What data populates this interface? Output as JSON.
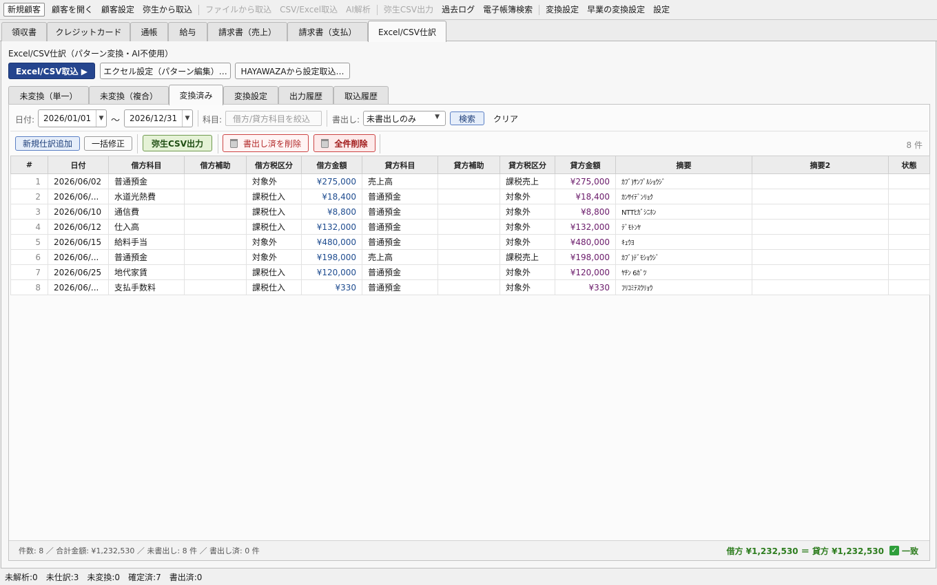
{
  "menu": {
    "new_customer": "新規顧客",
    "open_customer": "顧客を開く",
    "customer_settings": "顧客設定",
    "import_yayoi": "弥生から取込",
    "import_file": "ファイルから取込",
    "import_csv_excel": "CSV/Excel取込",
    "ai_analysis": "AI解析",
    "yayoi_csv_export": "弥生CSV出力",
    "past_log": "過去ログ",
    "e_ledger_search": "電子帳簿検索",
    "conversion_settings": "変換設定",
    "hayawaza_settings": "早業の変換設定",
    "settings": "設定"
  },
  "main_tabs": [
    "領収書",
    "クレジットカード",
    "通帳",
    "給与",
    "請求書（売上）",
    "請求書（支払）",
    "Excel/CSV仕訳"
  ],
  "panel": {
    "title": "Excel/CSV仕訳（パターン変換・AI不使用）",
    "import_button": "Excel/CSV取込 ▶",
    "excel_settings_button": "エクセル設定（パターン編集）…",
    "hayawaza_import_button": "HAYAWAZAから設定取込…"
  },
  "sub_tabs": [
    "未変換（単一）",
    "未変換（複合）",
    "変換済み",
    "変換設定",
    "出力履歴",
    "取込履歴"
  ],
  "filter": {
    "date_label": "日付:",
    "date_from": "2026/01/01",
    "tilde": "〜",
    "date_to": "2026/12/31",
    "account_label": "科目:",
    "account_placeholder": "借方/貸方科目を絞込",
    "export_label": "書出し:",
    "export_value": "未書出しのみ",
    "search_button": "検索",
    "clear_button": "クリア"
  },
  "actions": {
    "new_entry": "新規仕訳追加",
    "bulk_edit": "一括修正",
    "yayoi_csv": "弥生CSV出力",
    "delete_exported": "書出し済を削除",
    "delete_all": "全件削除",
    "count": "8 件"
  },
  "table": {
    "headers": [
      "#",
      "日付",
      "借方科目",
      "借方補助",
      "借方税区分",
      "借方金額",
      "貸方科目",
      "貸方補助",
      "貸方税区分",
      "貸方金額",
      "摘要",
      "摘要2",
      "状態"
    ],
    "rows": [
      {
        "num": "1",
        "date": "2026/06/02",
        "debit": "普通預金",
        "dsub": "",
        "dtax": "対象外",
        "damt": "¥275,000",
        "credit": "売上高",
        "csub": "",
        "ctax": "課税売上",
        "camt": "¥275,000",
        "memo": "ｶﾌﾞ)ｻﾝﾌﾟﾙｼｮｳｼﾞ",
        "memo2": "",
        "status": ""
      },
      {
        "num": "2",
        "date": "2026/06/...",
        "debit": "水道光熱費",
        "dsub": "",
        "dtax": "課税仕入",
        "damt": "¥18,400",
        "credit": "普通預金",
        "csub": "",
        "ctax": "対象外",
        "camt": "¥18,400",
        "memo": "ｶﾝｻｲﾃﾞﾝﾘｮｸ",
        "memo2": "",
        "status": ""
      },
      {
        "num": "3",
        "date": "2026/06/10",
        "debit": "通信費",
        "dsub": "",
        "dtax": "課税仕入",
        "damt": "¥8,800",
        "credit": "普通預金",
        "csub": "",
        "ctax": "対象外",
        "camt": "¥8,800",
        "memo": "NTTﾋｶﾞｼﾆﾎﾝ",
        "memo2": "",
        "status": ""
      },
      {
        "num": "4",
        "date": "2026/06/12",
        "debit": "仕入高",
        "dsub": "",
        "dtax": "課税仕入",
        "damt": "¥132,000",
        "credit": "普通預金",
        "csub": "",
        "ctax": "対象外",
        "camt": "¥132,000",
        "memo": "ﾃﾞﾓﾄﾝﾔ",
        "memo2": "",
        "status": ""
      },
      {
        "num": "5",
        "date": "2026/06/15",
        "debit": "給料手当",
        "dsub": "",
        "dtax": "対象外",
        "damt": "¥480,000",
        "credit": "普通預金",
        "csub": "",
        "ctax": "対象外",
        "camt": "¥480,000",
        "memo": "ｷｭｳﾖ",
        "memo2": "",
        "status": ""
      },
      {
        "num": "6",
        "date": "2026/06/...",
        "debit": "普通預金",
        "dsub": "",
        "dtax": "対象外",
        "damt": "¥198,000",
        "credit": "売上高",
        "csub": "",
        "ctax": "課税売上",
        "camt": "¥198,000",
        "memo": "ｶﾌﾞ)ﾃﾞﾓｼｮｳｼﾞ",
        "memo2": "",
        "status": ""
      },
      {
        "num": "7",
        "date": "2026/06/25",
        "debit": "地代家賃",
        "dsub": "",
        "dtax": "課税仕入",
        "damt": "¥120,000",
        "credit": "普通預金",
        "csub": "",
        "ctax": "対象外",
        "camt": "¥120,000",
        "memo": "ﾔﾁﾝ 6ｶﾞﾂ",
        "memo2": "",
        "status": ""
      },
      {
        "num": "8",
        "date": "2026/06/...",
        "debit": "支払手数料",
        "dsub": "",
        "dtax": "課税仕入",
        "damt": "¥330",
        "credit": "普通預金",
        "csub": "",
        "ctax": "対象外",
        "camt": "¥330",
        "memo": "ﾌﾘｺﾐﾃｽｳﾘｮｳ",
        "memo2": "",
        "status": ""
      }
    ]
  },
  "footer": {
    "stats": "件数: 8 ／ 合計金額: ¥1,232,530 ／ 未書出し: 8 件 ／ 書出し済: 0 件",
    "balance": "借方 ¥1,232,530 ＝ 貸方 ¥1,232,530",
    "match": "一致"
  },
  "status_bar": [
    "未解析:0",
    "未仕訳:3",
    "未変換:0",
    "確定済:7",
    "書出済:0"
  ]
}
